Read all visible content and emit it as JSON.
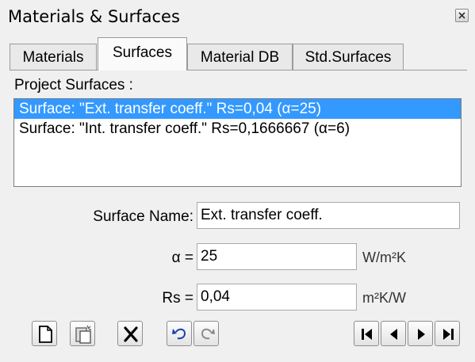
{
  "window": {
    "title": "Materials & Surfaces"
  },
  "tabs": [
    {
      "label": "Materials"
    },
    {
      "label": "Surfaces"
    },
    {
      "label": "Material DB"
    },
    {
      "label": "Std.Surfaces"
    }
  ],
  "active_tab": "Surfaces",
  "project_surfaces": {
    "label": "Project Surfaces :",
    "items": [
      {
        "text": "Surface: \"Ext. transfer coeff.\"  Rs=0,04  (α=25)",
        "selected": true
      },
      {
        "text": "Surface: \"Int. transfer coeff.\"  Rs=0,1666667  (α=6)",
        "selected": false
      }
    ]
  },
  "form": {
    "surface_name": {
      "label": "Surface Name:",
      "value": "Ext. transfer coeff."
    },
    "alpha": {
      "label": "α =",
      "value": "25",
      "unit": "W/m²K"
    },
    "rs": {
      "label": "Rs =",
      "value": "0,04",
      "unit": "m²K/W"
    }
  },
  "toolbar": {
    "buttons": [
      "new-icon",
      "paste-icon",
      "delete-icon",
      "undo-icon",
      "redo-icon",
      "first-icon",
      "previous-icon",
      "next-icon",
      "last-icon"
    ]
  },
  "colors": {
    "selection": "#3399ff",
    "window_bg": "#f0f0f0"
  }
}
